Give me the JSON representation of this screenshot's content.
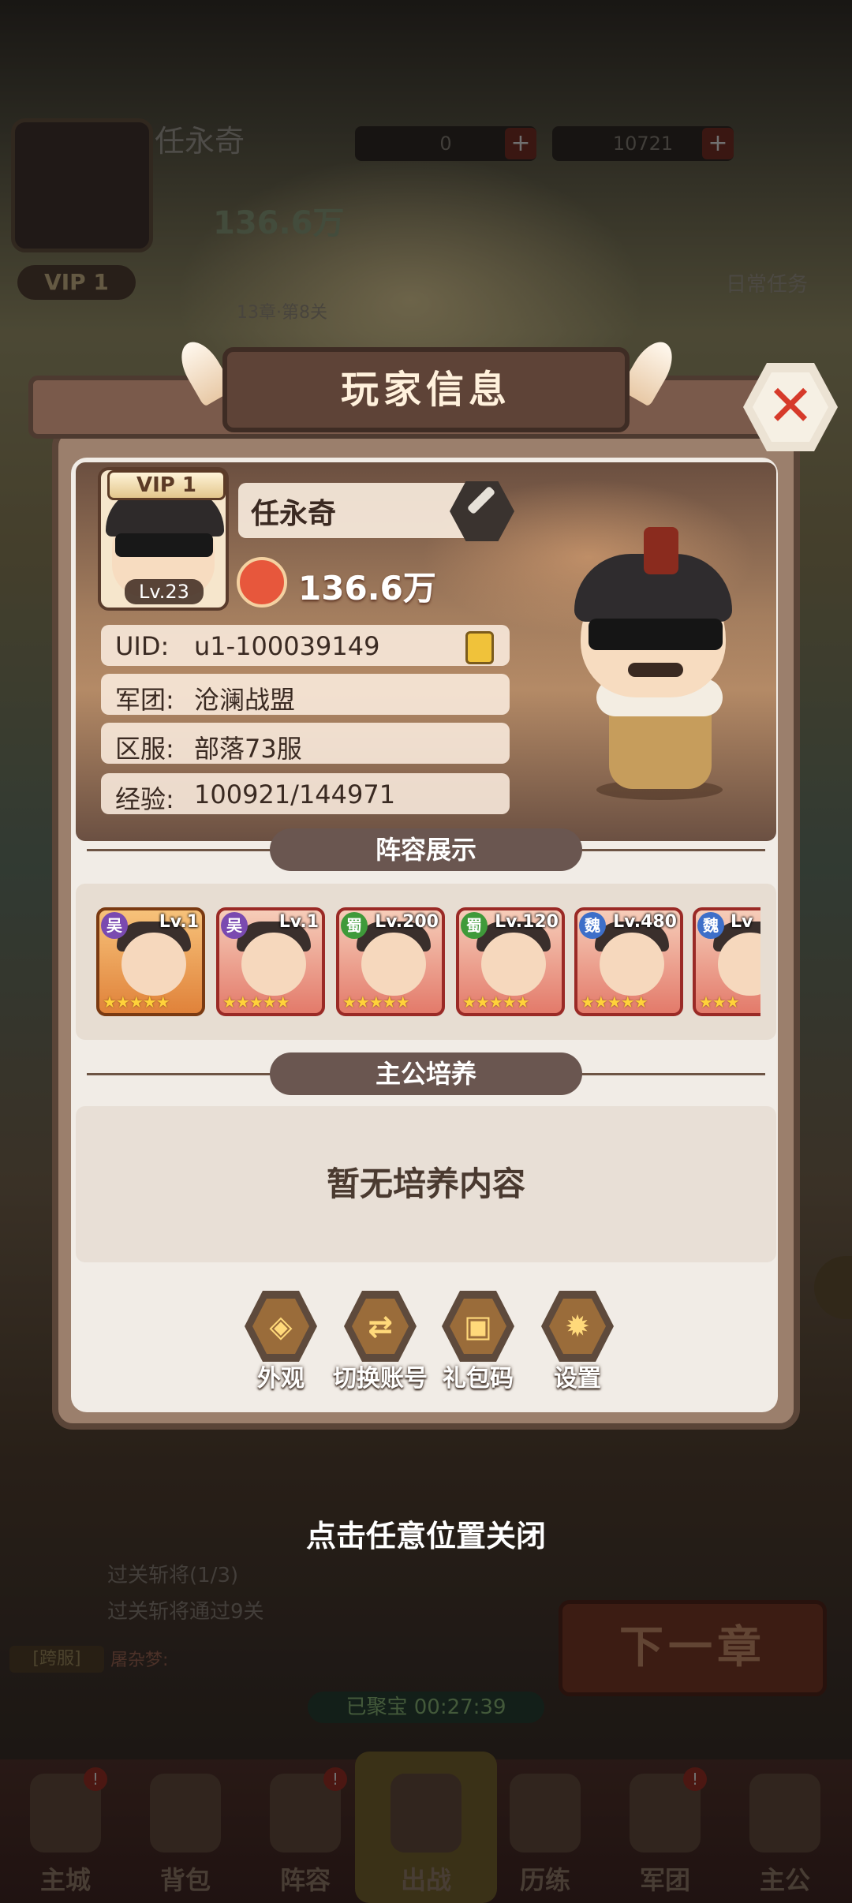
{
  "background": {
    "hud": {
      "player_name": "任永奇",
      "power": "136.6万",
      "vip": "VIP 1",
      "avatar_level": "Lv.23",
      "resource_gems": "0",
      "resource_gold": "10721",
      "stage": "13章·第8关",
      "daily_task": "日常任务"
    },
    "quests": [
      "过关斩将(1/3)",
      "过关斩将通过9关"
    ],
    "chat_tag": "[跨服]",
    "chat_name": "屠杂梦:",
    "timer": "已聚宝 00:27:39",
    "next_chapter": "下一章",
    "nav": [
      {
        "label": "主城",
        "badge": "!"
      },
      {
        "label": "背包",
        "badge": ""
      },
      {
        "label": "阵容",
        "badge": "!"
      },
      {
        "label": "出战",
        "badge": ""
      },
      {
        "label": "历练",
        "badge": ""
      },
      {
        "label": "军团",
        "badge": "!"
      },
      {
        "label": "主公",
        "badge": ""
      }
    ]
  },
  "dialog": {
    "title": "玩家信息",
    "close_glyph": "✕",
    "vip_badge": "VIP  1",
    "avatar_level": "Lv.23",
    "player_name": "任永奇",
    "power": "136.6万",
    "info_rows": [
      {
        "label": "UID:",
        "value": "u1-100039149"
      },
      {
        "label": "军团:",
        "value": "沧澜战盟"
      },
      {
        "label": "区服:",
        "value": "部落73服"
      },
      {
        "label": "经验:",
        "value": "100921/144971"
      }
    ],
    "lineup_title": "阵容展示",
    "lineup": [
      {
        "faction": "吴",
        "level": "Lv.1",
        "stars": "★★★★★",
        "frame": "orange"
      },
      {
        "faction": "吴",
        "level": "Lv.1",
        "stars": "★★★★★",
        "frame": "red"
      },
      {
        "faction": "蜀",
        "level": "Lv.200",
        "stars": "★★★★★",
        "frame": "red"
      },
      {
        "faction": "蜀",
        "level": "Lv.120",
        "stars": "★★★★★",
        "frame": "red"
      },
      {
        "faction": "魏",
        "level": "Lv.480",
        "stars": "★★★★★",
        "frame": "red"
      },
      {
        "faction": "魏",
        "level": "Lv",
        "stars": "★★★",
        "frame": "red"
      }
    ],
    "cultivation_title": "主公培养",
    "cultivation_empty": "暂无培养内容",
    "actions": [
      {
        "label": "外观",
        "icon": "mask-icon",
        "glyph": "◈"
      },
      {
        "label": "切换账号",
        "icon": "switch-account-icon",
        "glyph": "⇄"
      },
      {
        "label": "礼包码",
        "icon": "gift-code-icon",
        "glyph": "▣"
      },
      {
        "label": "设置",
        "icon": "settings-gear-icon",
        "glyph": "✹"
      }
    ]
  },
  "hint": "点击任意位置关闭",
  "colors": {
    "accent_red": "#d63a2a",
    "panel_brown": "#9b7f6c",
    "star_gold": "#ffd23a"
  }
}
